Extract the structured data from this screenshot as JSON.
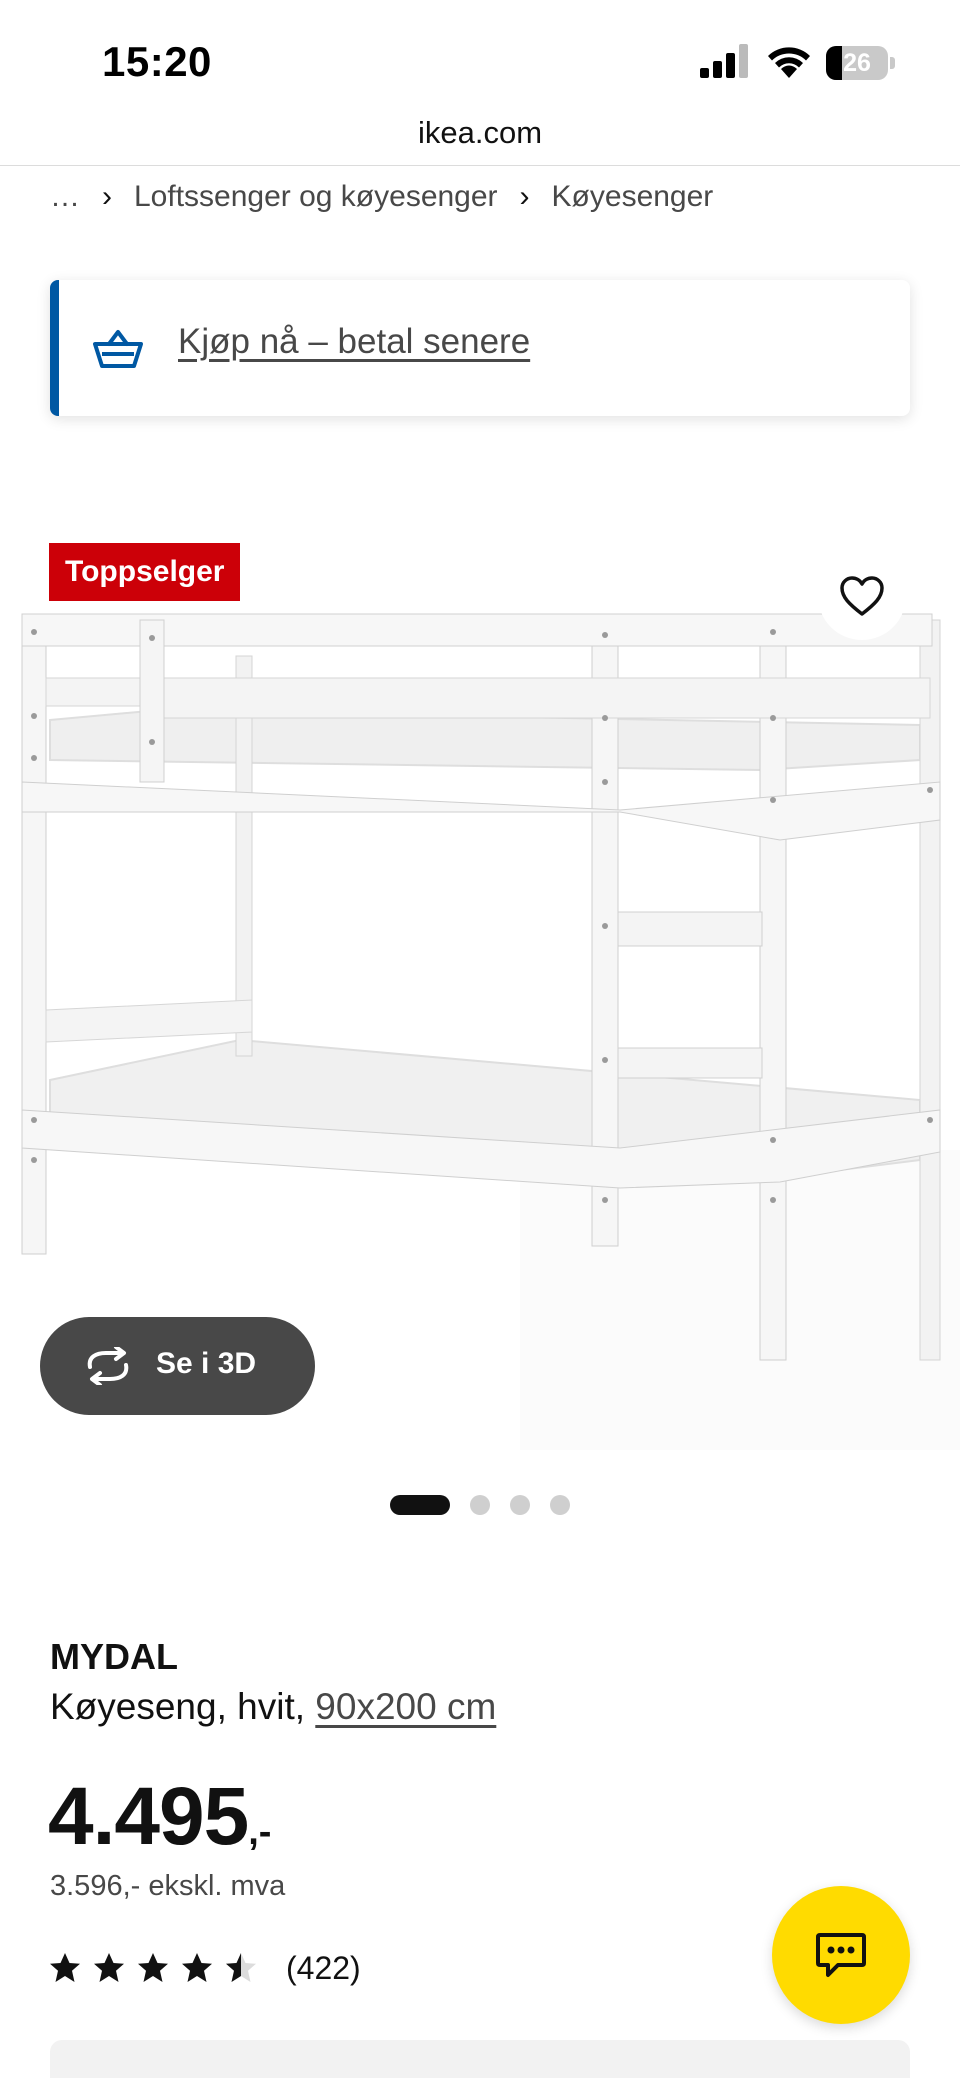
{
  "status_bar": {
    "time": "15:20",
    "battery": "26",
    "battery_level": 0.26
  },
  "browser": {
    "url": "ikea.com"
  },
  "breadcrumb": {
    "items": [
      "…",
      "Loftssenger og køyesenger",
      "Køyesenger"
    ],
    "separator": "›"
  },
  "banner": {
    "text": "Kjøp nå – betal senere",
    "icon": "shopping-basket-icon",
    "accent_color": "#0058a3"
  },
  "product_image": {
    "badge": "Toppselger",
    "badge_color": "#cc0008",
    "favorite_icon": "heart-icon",
    "view_3d_label": "Se i 3D",
    "view_3d_icon": "rotate-3d-icon",
    "carousel": {
      "total": 4,
      "active": 1
    }
  },
  "product": {
    "name": "MYDAL",
    "type": "Køyeseng, hvit,",
    "size": "90x200 cm",
    "price_integer": "4.495",
    "price_decimal": ",-",
    "price_ex_vat": "3.596,- ekskl. mva",
    "rating": 4.5,
    "rating_max": 5,
    "review_count": "(422)"
  },
  "chat": {
    "icon": "chat-bubble-icon",
    "color": "#ffdb00"
  }
}
